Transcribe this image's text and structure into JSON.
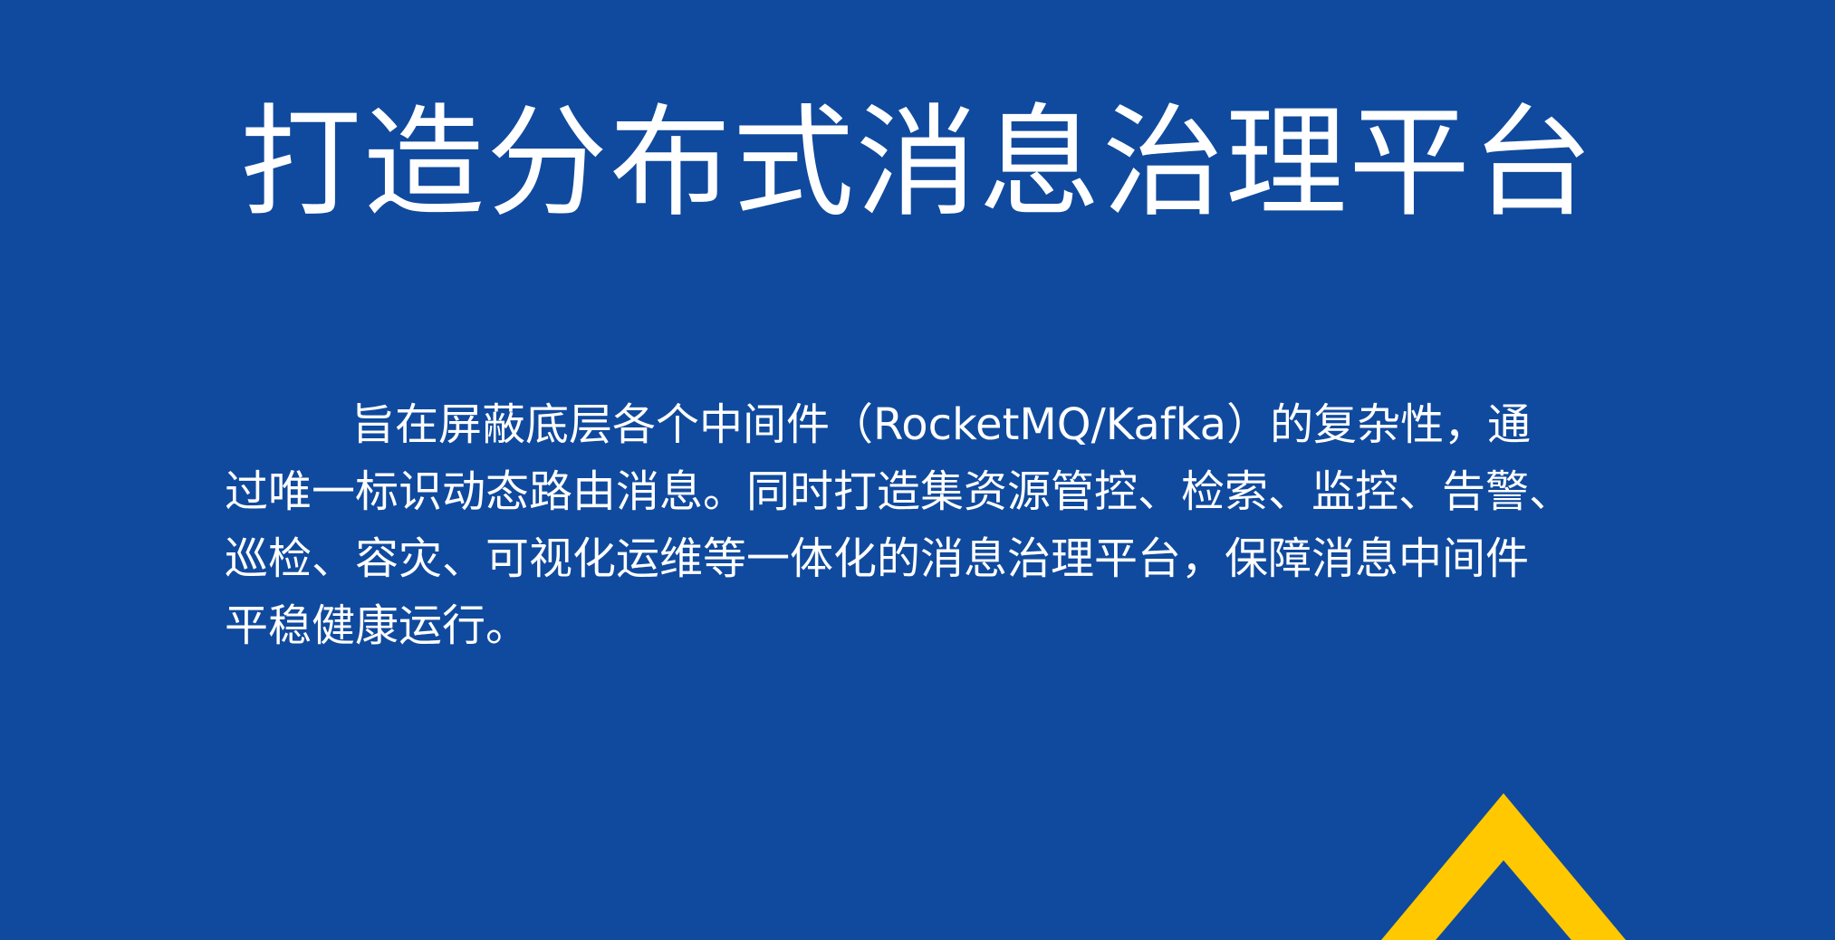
{
  "slide": {
    "title": "打造分布式消息治理平台",
    "description_lines": [
      "旨在屏蔽底层各个中间件（RocketMQ/Kafka）的复杂性，通",
      "过唯一标识动态路由消息。同时打造集资源管控、检索、监控、告警、",
      "巡检、容灾、可视化运维等一体化的消息治理平台，保障消息中间件",
      "平稳健康运行。"
    ]
  },
  "colors": {
    "background": "#104a9e",
    "text": "#ffffff",
    "accent": "#ffc800"
  },
  "decoration": {
    "icon": "yellow-chevron-triangle-icon"
  }
}
